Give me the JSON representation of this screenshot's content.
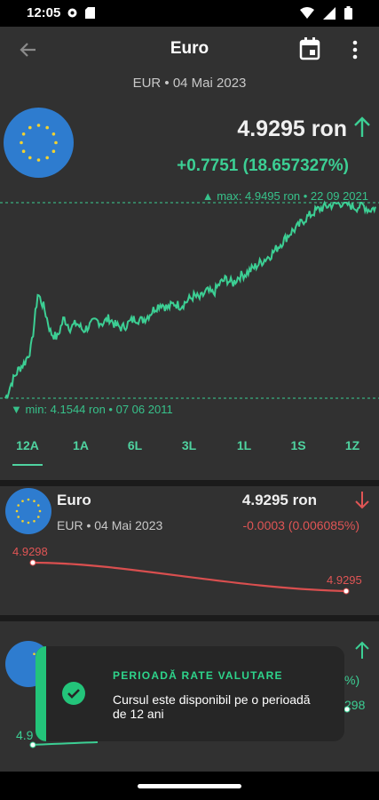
{
  "status": {
    "time": "12:05"
  },
  "appbar": {
    "title": "Euro",
    "subtitle": "EUR • 04 Mai 2023"
  },
  "main": {
    "price": "4.9295 ron",
    "change": "+0.7751 (18.657327%)",
    "max_label": "▲ max: 4.9495 ron • 22 09 2021",
    "min_label": "▼ min: 4.1544 ron • 07 06 2011"
  },
  "periods": [
    "12A",
    "1A",
    "6L",
    "3L",
    "1L",
    "1S",
    "1Z"
  ],
  "active_period": "12A",
  "card1": {
    "name": "Euro",
    "sub": "EUR • 04 Mai 2023",
    "price": "4.9295 ron",
    "change": "-0.0003 (0.006085%)",
    "start_value": "4.9298",
    "end_value": "4.9295"
  },
  "card2": {
    "partial_change": "%)",
    "partial_end_value": "298",
    "partial_start_value": "4.9"
  },
  "toast": {
    "title": "PERIOADĂ RATE VALUTARE",
    "message": "Cursul este disponibil pe o perioadă de 12 ani"
  },
  "colors": {
    "accent": "#3ccf94",
    "negative": "#e05555",
    "background": "#313131",
    "flag": "#2e7ccf"
  },
  "chart_data": {
    "type": "line",
    "x_range": [
      "07 06 2011",
      "04 05 2023"
    ],
    "ylim": [
      4.1544,
      4.9495
    ],
    "series": [
      {
        "values": [
          4.15,
          4.22,
          4.27,
          4.3,
          4.36,
          4.58,
          4.52,
          4.42,
          4.4,
          4.48,
          4.44,
          4.46,
          4.43,
          4.45,
          4.47,
          4.46,
          4.48,
          4.45,
          4.44,
          4.46,
          4.48,
          4.47,
          4.49,
          4.52,
          4.54,
          4.52,
          4.54,
          4.53,
          4.55,
          4.57,
          4.56,
          4.59,
          4.58,
          4.62,
          4.64,
          4.62,
          4.65,
          4.66,
          4.68,
          4.7,
          4.72,
          4.74,
          4.77,
          4.8,
          4.83,
          4.85,
          4.88,
          4.9,
          4.92,
          4.93,
          4.94,
          4.945,
          4.9495,
          4.94,
          4.93,
          4.94,
          4.92,
          4.9295
        ]
      }
    ]
  }
}
